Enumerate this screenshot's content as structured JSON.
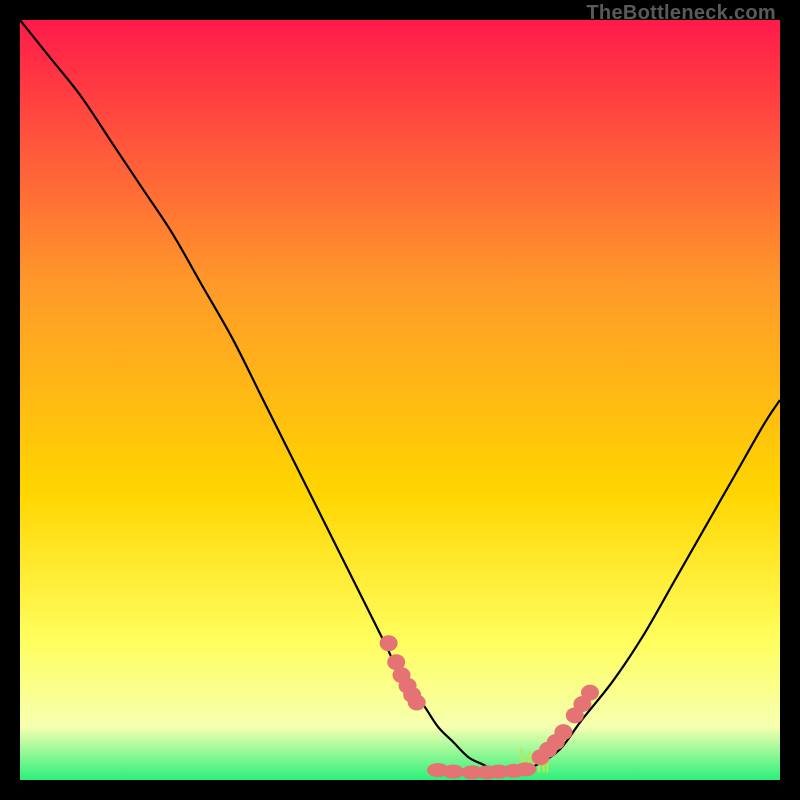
{
  "watermark": "TheBottleneck.com",
  "colors": {
    "gradient_top": "#ff1a4a",
    "gradient_mid1": "#ff9a2a",
    "gradient_mid2": "#ffd500",
    "gradient_mid3": "#ffff60",
    "gradient_bottom_band": "#f6ffb0",
    "gradient_green": "#2cf07a",
    "curve": "#000000",
    "marker": "#e57373"
  },
  "chart_data": {
    "type": "line",
    "title": "",
    "xlabel": "",
    "ylabel": "",
    "xlim": [
      0,
      100
    ],
    "ylim": [
      0,
      100
    ],
    "curve": {
      "x": [
        0,
        4,
        8,
        12,
        16,
        20,
        24,
        28,
        32,
        36,
        40,
        44,
        48,
        50,
        53,
        55,
        57,
        59,
        61,
        63,
        65,
        68,
        71,
        74,
        78,
        82,
        86,
        90,
        94,
        98,
        100
      ],
      "y": [
        100,
        95,
        90,
        84,
        78,
        72,
        65,
        58,
        50,
        42,
        34,
        26,
        18,
        14,
        10,
        7,
        5,
        3,
        2,
        1,
        1,
        2,
        4,
        8,
        13,
        19,
        26,
        33,
        40,
        47,
        50
      ]
    },
    "markers_left": {
      "x": [
        48.5,
        49.5,
        50.2,
        51.0,
        51.6,
        52.2
      ],
      "y": [
        18.0,
        15.5,
        13.8,
        12.4,
        11.2,
        10.2
      ]
    },
    "markers_bottom": {
      "x": [
        55.0,
        57.0,
        59.5,
        61.5,
        63.0,
        65.0,
        66.5
      ],
      "y": [
        1.3,
        1.1,
        1.0,
        1.0,
        1.1,
        1.2,
        1.4
      ]
    },
    "markers_right": {
      "x": [
        68.5,
        69.5,
        70.5,
        71.5,
        73.0,
        74.0,
        75.0
      ],
      "y": [
        3.0,
        4.0,
        5.0,
        6.3,
        8.5,
        10.0,
        11.5
      ]
    },
    "noise_spikes": {
      "x": [
        66,
        66.5,
        67,
        67.6,
        68.3,
        68.9,
        69.4
      ],
      "h": [
        3.2,
        2.1,
        2.8,
        1.9,
        2.4,
        1.6,
        2.0
      ]
    }
  }
}
